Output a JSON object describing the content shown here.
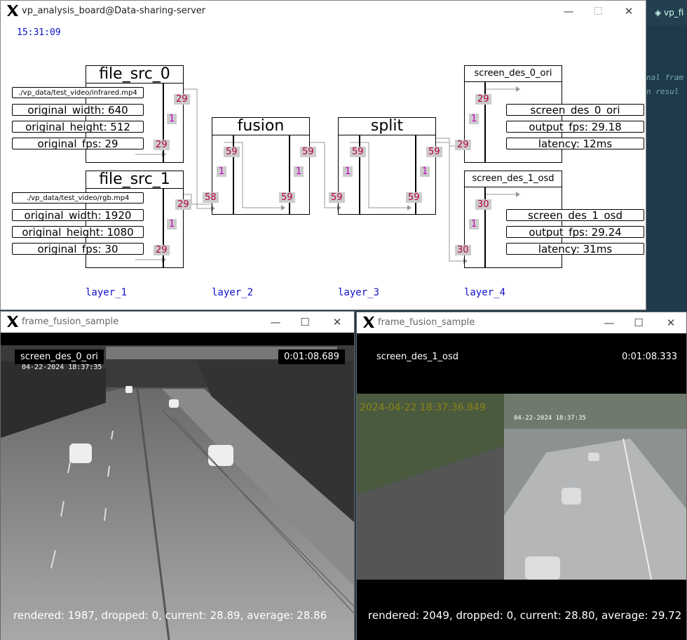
{
  "board": {
    "title": "vp_analysis_board@Data-sharing-server",
    "time": "15:31:09",
    "layers": [
      "layer_1",
      "layer_2",
      "layer_3",
      "layer_4"
    ],
    "nodes": {
      "src0": {
        "title": "file_src_0",
        "fields": [
          "./vp_data/test_video/infrared.mp4",
          "original_width: 640",
          "original_height: 512",
          "original_fps: 29"
        ],
        "out_badge": "29",
        "mid_badge": "1",
        "in_badge": "29"
      },
      "src1": {
        "title": "file_src_1",
        "fields": [
          "./vp_data/test_video/rgb.mp4",
          "original_width: 1920",
          "original_height: 1080",
          "original_fps: 30"
        ],
        "out_badge": "29",
        "mid_badge": "1",
        "in_badge": "29"
      },
      "fusion": {
        "title": "fusion",
        "badges": [
          "59",
          "59",
          "1",
          "1",
          "58",
          "59"
        ]
      },
      "split": {
        "title": "split",
        "badges": [
          "59",
          "59",
          "1",
          "1",
          "59",
          "59"
        ]
      },
      "des0": {
        "title": "screen_des_0_ori",
        "fields": [
          "screen_des_0_ori",
          "output_fps: 29.18",
          "latency: 12ms"
        ],
        "badges": [
          "29",
          "1",
          "29"
        ]
      },
      "des1": {
        "title": "screen_des_1_osd",
        "fields": [
          "screen_des_1_osd",
          "output_fps: 29.24",
          "latency: 31ms"
        ],
        "badges": [
          "30",
          "1",
          "30"
        ]
      }
    }
  },
  "editor_edge": {
    "tab": "vp_fi",
    "lines": [
      "nal fram",
      "n resul"
    ]
  },
  "video_left": {
    "title": "frame_fusion_sample",
    "label": "screen_des_0_ori",
    "timecode": "0:01:08.689",
    "cam_time": "04-22-2024 18:37:35",
    "stats": "rendered: 1987, dropped: 0, current: 28.89, average: 28.86"
  },
  "video_right": {
    "title": "frame_fusion_sample",
    "label": "screen_des_1_osd",
    "timecode": "0:01:08.333",
    "osd_time": "2024-04-22 18:37:36.849",
    "cam_time": "04-22-2024 18:37:35",
    "stats": "rendered: 2049, dropped: 0, current: 28.80, average: 29.72"
  },
  "window_buttons": {
    "minimize": "—",
    "maximize": "☐",
    "close": "✕"
  },
  "colors": {
    "badge_bg": "#cccccc",
    "badge_text": "#b3003a",
    "badge_mid": "#c000c0",
    "layer_label": "#1010c8",
    "osd_text": "#b5a000"
  }
}
